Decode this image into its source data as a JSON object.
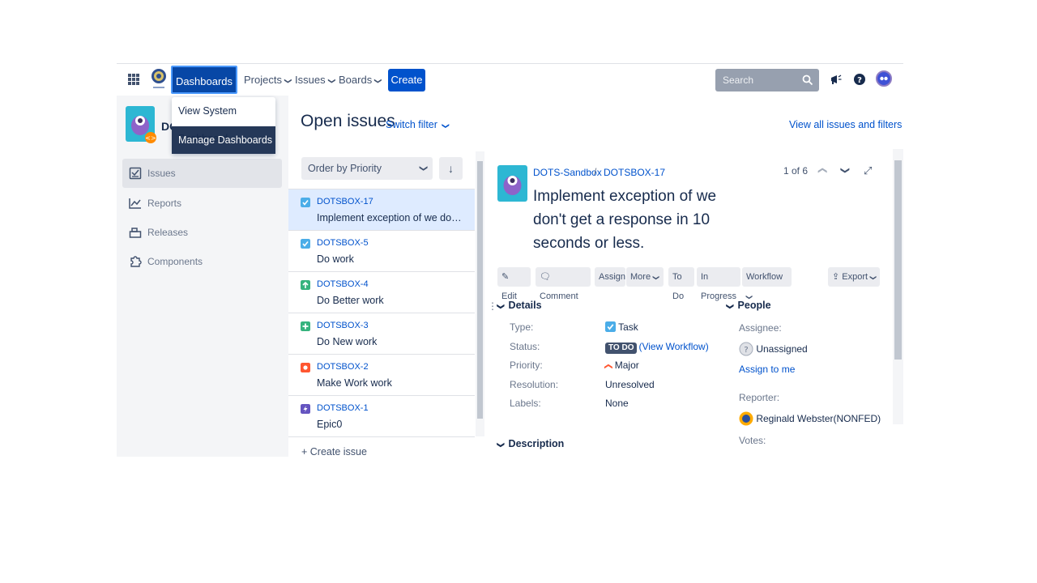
{
  "header": {
    "nav": {
      "dashboards": "Dashboards",
      "projects": "Projects",
      "issues": "Issues",
      "boards": "Boards"
    },
    "create_label": "Create",
    "search_placeholder": "Search"
  },
  "dashboards_menu": {
    "items": [
      "View System Dashboard",
      "Manage Dashboards"
    ],
    "active_index": 1
  },
  "sidebar": {
    "project_name": "DO",
    "items": [
      {
        "label": "Issues",
        "icon": "issues-icon",
        "active": true
      },
      {
        "label": "Reports",
        "icon": "reports-icon"
      },
      {
        "label": "Releases",
        "icon": "releases-icon"
      },
      {
        "label": "Components",
        "icon": "components-icon"
      }
    ]
  },
  "main": {
    "title": "Open issues",
    "switch_filter": "Switch filter",
    "view_all": "View all issues and filters",
    "order_by": "Order by Priority",
    "create_issue": "+ Create issue"
  },
  "issues": [
    {
      "key": "DOTSBOX-17",
      "summary": "Implement exception of we don't get a response in 10 seconds or less.",
      "type": "task",
      "color": "#4bade8"
    },
    {
      "key": "DOTSBOX-5",
      "summary": "Do work",
      "type": "task",
      "color": "#4bade8"
    },
    {
      "key": "DOTSBOX-4",
      "summary": "Do Better work",
      "type": "improvement",
      "color": "#36b37e"
    },
    {
      "key": "DOTSBOX-3",
      "summary": "Do New work",
      "type": "new-feature",
      "color": "#36b37e"
    },
    {
      "key": "DOTSBOX-2",
      "summary": "Make Work work",
      "type": "bug",
      "color": "#ff5630"
    },
    {
      "key": "DOTSBOX-1",
      "summary": "Epic0",
      "type": "epic",
      "color": "#6554c0"
    }
  ],
  "detail": {
    "project": "DOTS-Sandbox",
    "key": "DOTSBOX-17",
    "title": "Implement exception of we don't get a response in 10 seconds or less.",
    "pager": "1 of 6",
    "toolbar": {
      "edit": "Edit",
      "comment": "Comment",
      "assign": "Assign",
      "more": "More",
      "todo": "To Do",
      "in_progress": "In Progress",
      "workflow": "Workflow",
      "export": "Export"
    },
    "details_title": "Details",
    "people_title": "People",
    "description_title": "Description",
    "fields": {
      "type_label": "Type:",
      "type_value": "Task",
      "status_label": "Status:",
      "status_badge": "TO DO",
      "status_link": "(View Workflow)",
      "priority_label": "Priority:",
      "priority_value": "Major",
      "resolution_label": "Resolution:",
      "resolution_value": "Unresolved",
      "labels_label": "Labels:",
      "labels_value": "None"
    },
    "people": {
      "assignee_label": "Assignee:",
      "assignee_value": "Unassigned",
      "assign_to_me": "Assign to me",
      "reporter_label": "Reporter:",
      "reporter_value": "Reginald Webster(NONFED)",
      "votes_label": "Votes:"
    }
  }
}
